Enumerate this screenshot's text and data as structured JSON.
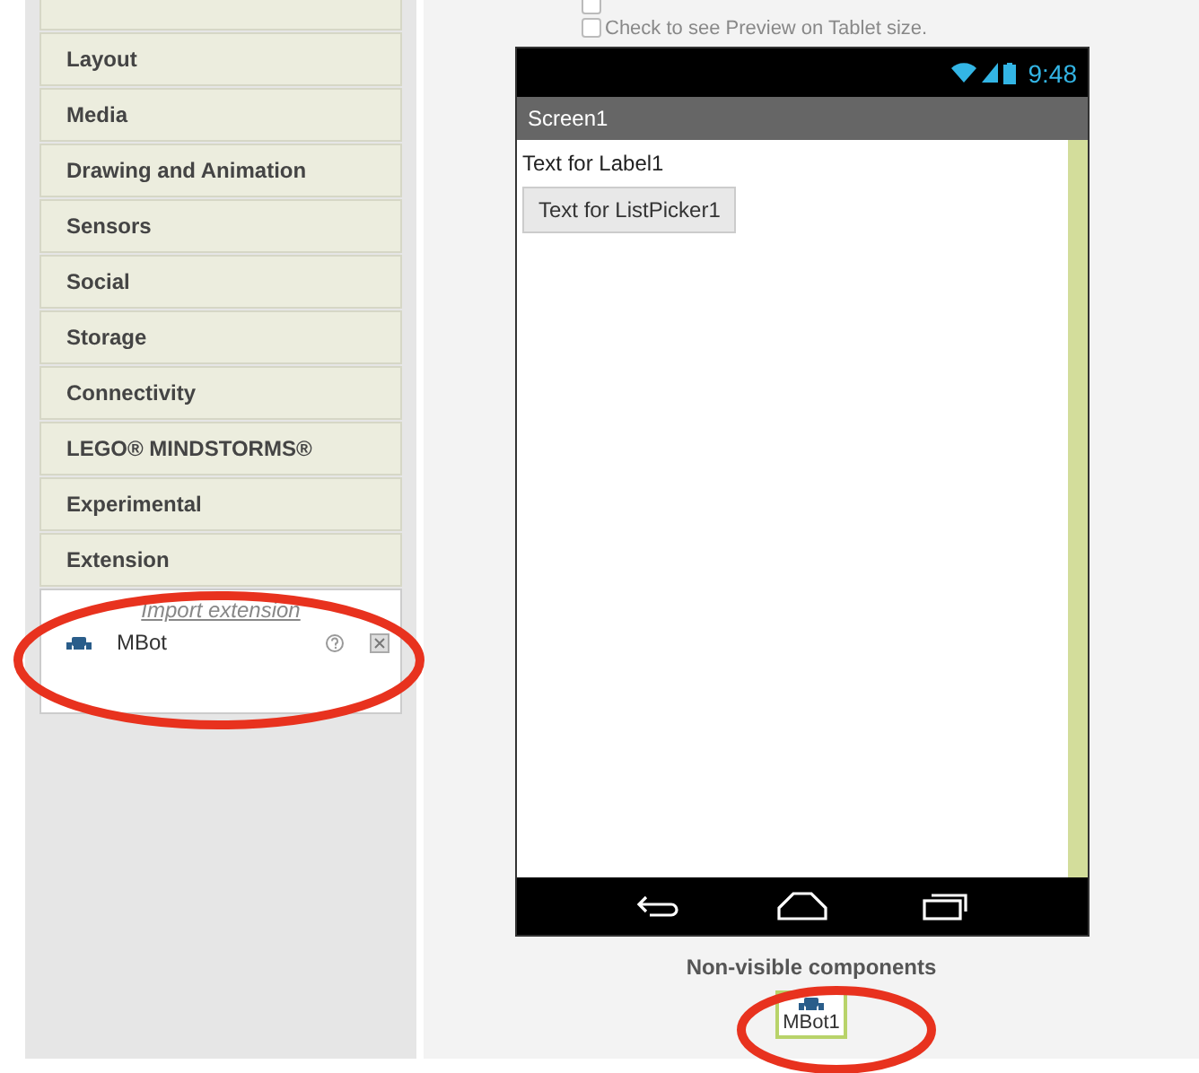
{
  "palette": {
    "categories": [
      {
        "label": "Layout"
      },
      {
        "label": "Media"
      },
      {
        "label": "Drawing and Animation"
      },
      {
        "label": "Sensors"
      },
      {
        "label": "Social"
      },
      {
        "label": "Storage"
      },
      {
        "label": "Connectivity"
      },
      {
        "label": "LEGO® MINDSTORMS®"
      },
      {
        "label": "Experimental"
      },
      {
        "label": "Extension"
      }
    ],
    "import_link": "Import extension",
    "extensions": [
      {
        "name": "MBot"
      }
    ]
  },
  "viewer": {
    "options": [
      {
        "checked": false
      },
      {
        "label": "Check to see Preview on Tablet size.",
        "checked": false
      }
    ],
    "phone": {
      "time": "9:48",
      "screen_title": "Screen1",
      "components": [
        {
          "kind": "label",
          "text": "Text for Label1"
        },
        {
          "kind": "button",
          "text": "Text for ListPicker1"
        }
      ]
    },
    "non_visible": {
      "heading": "Non-visible components",
      "items": [
        {
          "name": "MBot1"
        }
      ]
    }
  }
}
